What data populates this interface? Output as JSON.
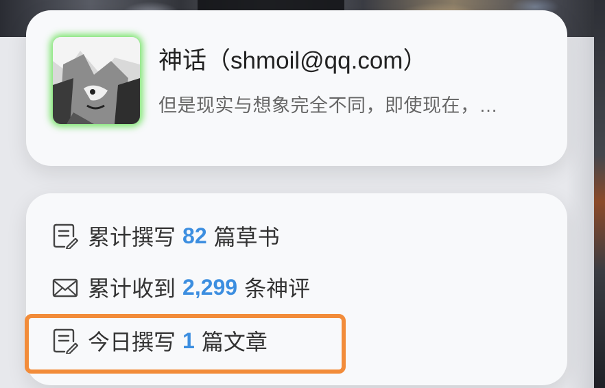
{
  "profile": {
    "name": "神话（shmoil@qq.com）",
    "bio": "但是现实与想象完全不同，即使现在，…"
  },
  "stats": [
    {
      "icon": "document-icon",
      "prefix": "累计撰写",
      "value": "82",
      "suffix": "篇草书"
    },
    {
      "icon": "envelope-icon",
      "prefix": "累计收到",
      "value": "2,299",
      "suffix": "条神评"
    },
    {
      "icon": "document-icon",
      "prefix": "今日撰写",
      "value": "1",
      "suffix": "篇文章"
    }
  ],
  "colors": {
    "accent_number": "#3c8ee0",
    "highlight_border": "#f28c3a",
    "avatar_glow": "#50dc3c",
    "card_bg": "#f8f9fb"
  }
}
